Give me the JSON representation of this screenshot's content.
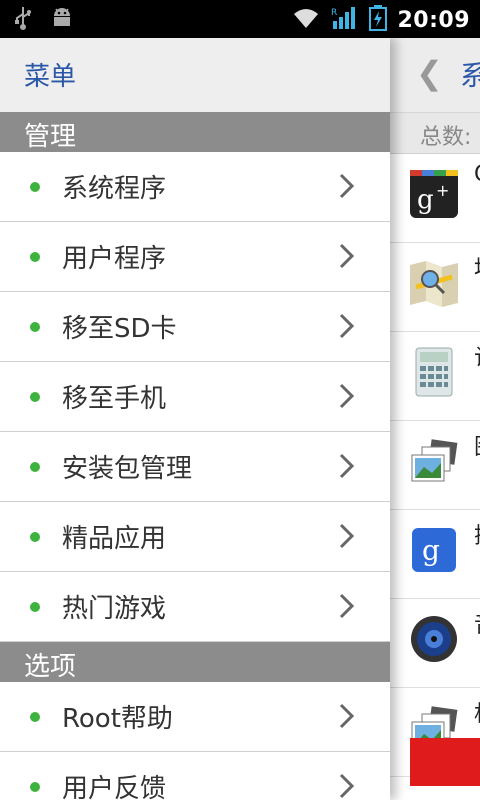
{
  "status_bar": {
    "time": "20:09",
    "icons": [
      "usb-icon",
      "android-debug-icon",
      "wifi-icon",
      "signal-icon",
      "battery-charging-icon"
    ],
    "signal_label": "R"
  },
  "drawer": {
    "title": "菜单",
    "sections": [
      {
        "title": "管理",
        "items": [
          {
            "label": "系统程序"
          },
          {
            "label": "用户程序"
          },
          {
            "label": "移至SD卡"
          },
          {
            "label": "移至手机"
          },
          {
            "label": "安装包管理"
          },
          {
            "label": "精品应用"
          },
          {
            "label": "热门游戏"
          }
        ]
      },
      {
        "title": "选项",
        "items": [
          {
            "label": "Root帮助"
          },
          {
            "label": "用户反馈"
          }
        ]
      }
    ]
  },
  "main_panel": {
    "back_icon": "chevron-left-icon",
    "title": "系",
    "count_label": "总数:",
    "apps": [
      {
        "icon": "google-plus-icon",
        "initial": "G"
      },
      {
        "icon": "maps-icon",
        "initial": "地"
      },
      {
        "icon": "calculator-icon",
        "initial": "计"
      },
      {
        "icon": "gallery-icon",
        "initial": "图"
      },
      {
        "icon": "google-search-icon",
        "initial": "搜"
      },
      {
        "icon": "speaker-icon",
        "initial": "音"
      },
      {
        "icon": "gallery-icon",
        "initial": "相"
      }
    ]
  },
  "colors": {
    "accent_blue": "#2a57a8",
    "dot_green": "#3eb23e",
    "section_gray": "#8c8c8c",
    "action_red": "#e01b1b"
  }
}
